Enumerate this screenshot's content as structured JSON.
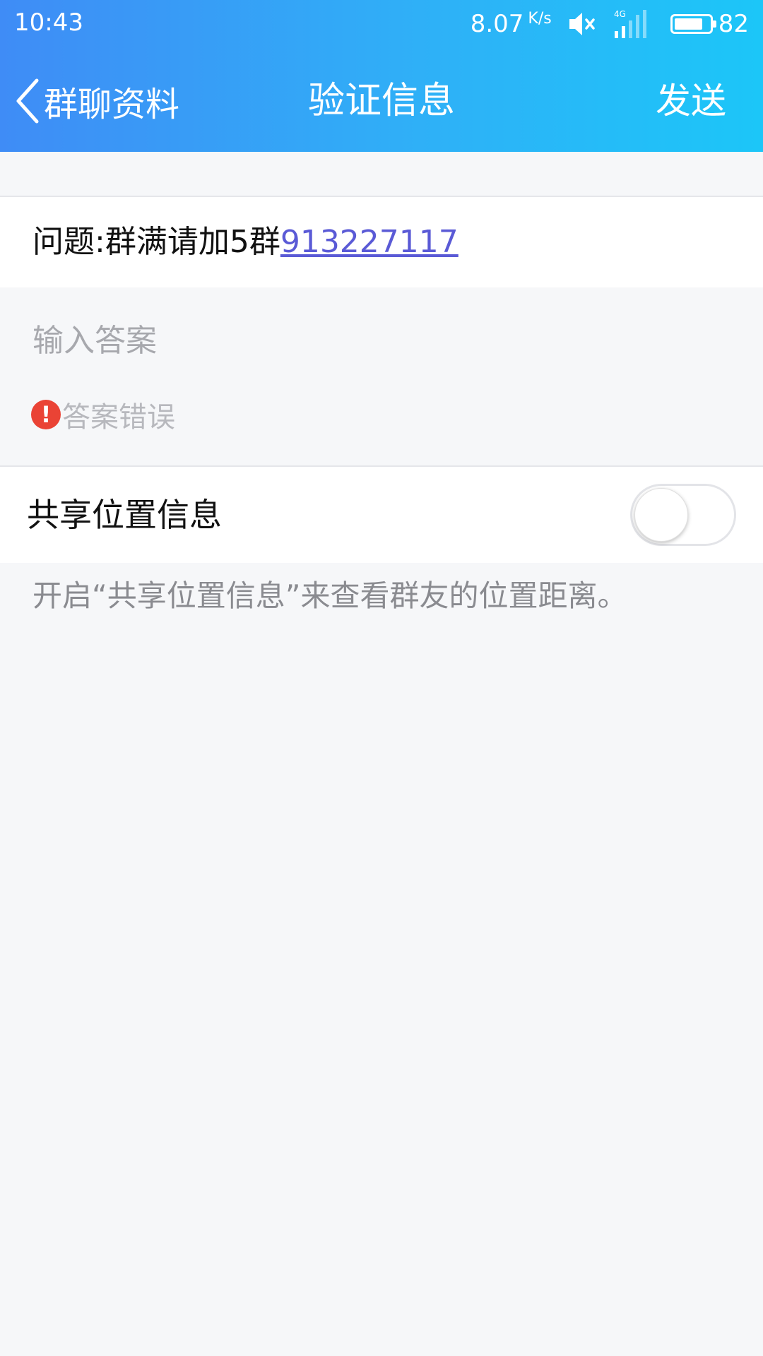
{
  "status_bar": {
    "time": "10:43",
    "speed_value": "8.07",
    "speed_unit": "K/s",
    "network_label": "4G",
    "battery_level": "82",
    "icons": [
      "mute-icon",
      "signal-icon",
      "battery-icon"
    ]
  },
  "nav": {
    "back_label": "群聊资料",
    "title": "验证信息",
    "send_label": "发送"
  },
  "question": {
    "prefix": "问题:群满请加5群",
    "link_text": "913227117",
    "link_color": "#5a5ad6"
  },
  "answer": {
    "value": "",
    "placeholder": "输入答案"
  },
  "error": {
    "text": "答案错误",
    "icon_glyph": "!",
    "icon_color": "#ea4335"
  },
  "share_location": {
    "label": "共享位置信息",
    "enabled": false
  },
  "hint": {
    "text": "开启“共享位置信息”来查看群友的位置距离。"
  },
  "colors": {
    "header_gradient_start": "#3f8cf6",
    "header_gradient_end": "#1cc6f8",
    "page_background": "#f6f7f9"
  }
}
